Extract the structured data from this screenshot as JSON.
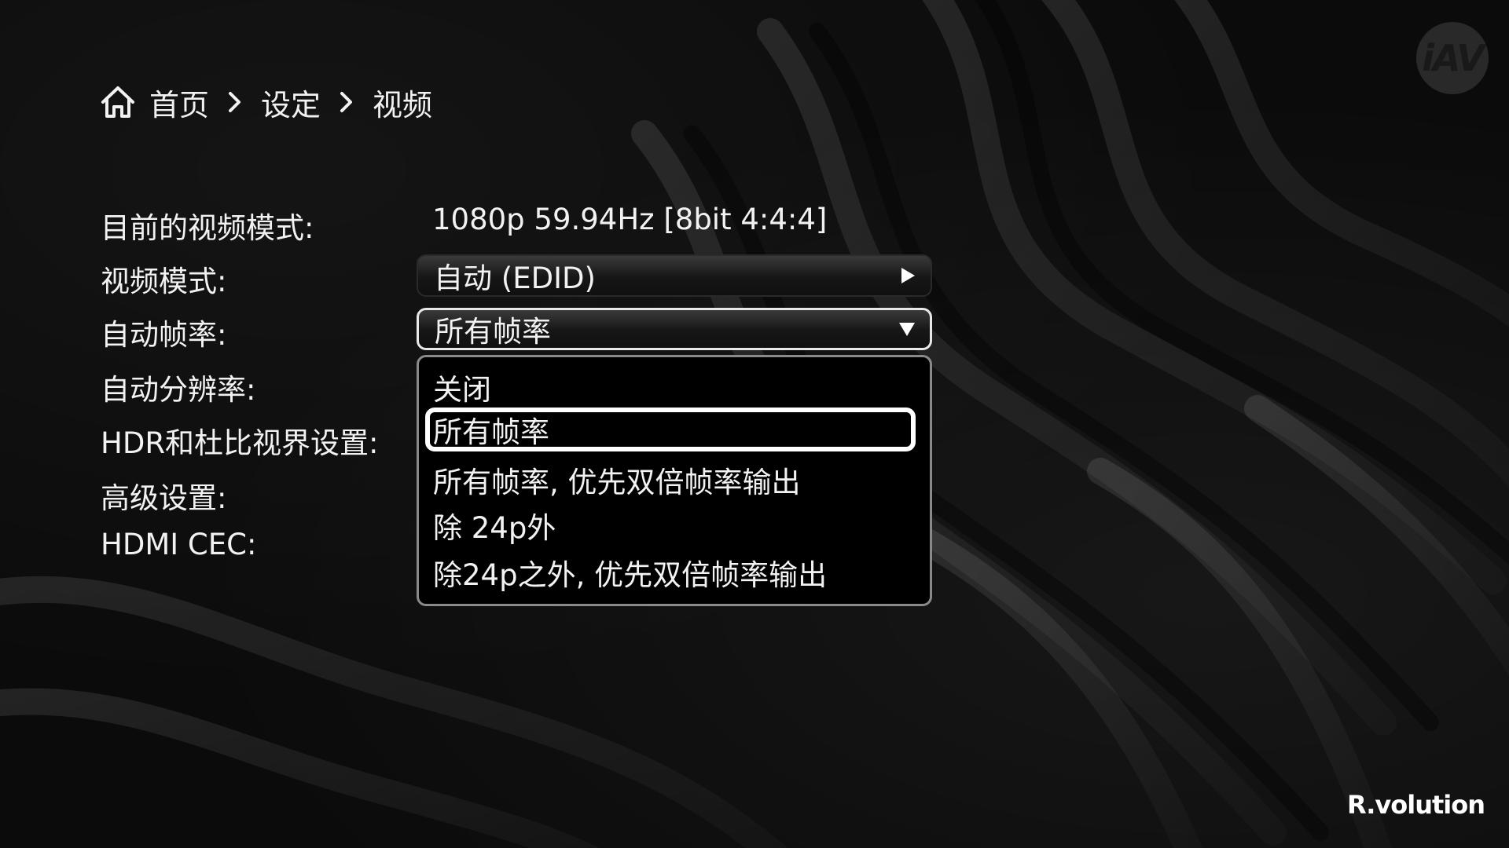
{
  "breadcrumb": {
    "items": [
      "首页",
      "设定",
      "视频"
    ]
  },
  "settings": {
    "current_mode_label": "目前的视频模式:",
    "current_mode_value": "1080p 59.94Hz [8bit 4:4:4]",
    "video_mode_label": "视频模式:",
    "video_mode_value": "自动 (EDID)",
    "auto_framerate_label": "自动帧率:",
    "auto_framerate_value": "所有帧率",
    "auto_resolution_label": "自动分辨率:",
    "hdr_label": "HDR和杜比视界设置:",
    "advanced_label": "高级设置:",
    "hdmi_cec_label": "HDMI CEC:"
  },
  "dropdown": {
    "options": [
      "关闭",
      "所有帧率",
      "所有帧率, 优先双倍帧率输出",
      "除 24p外",
      "除24p之外, 优先双倍帧率输出"
    ],
    "selected_index": 1
  },
  "logos": {
    "top_right": "iAV",
    "bottom_right": "R.volution"
  },
  "colors": {
    "text": "#f2f2f2",
    "focus_border": "#ffffff",
    "dropdown_border": "#8a8a8a"
  }
}
